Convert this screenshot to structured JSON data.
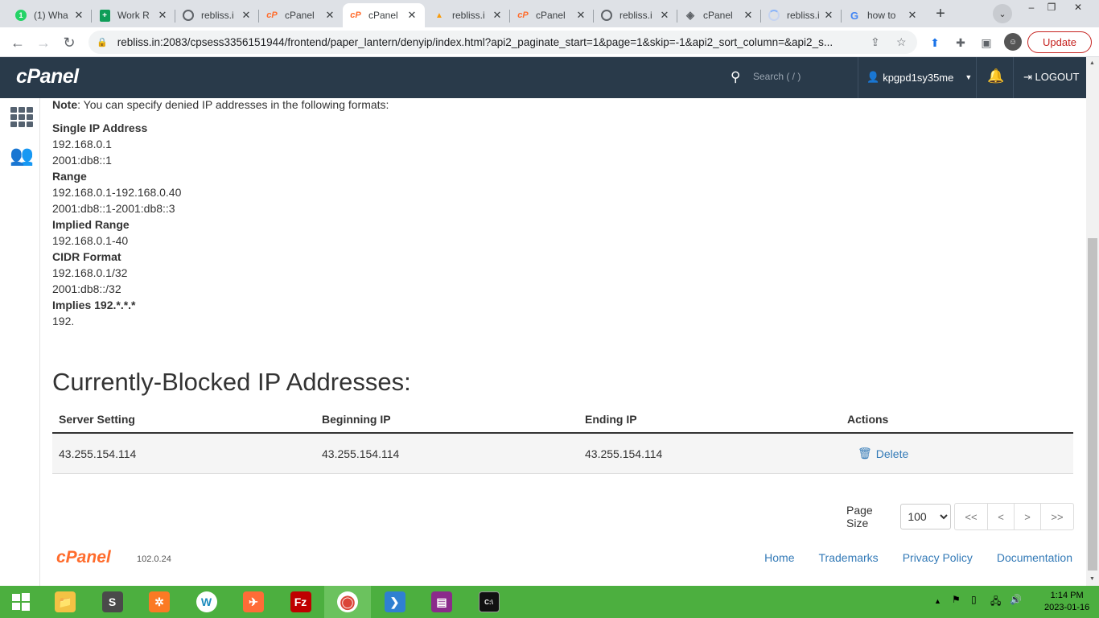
{
  "browser": {
    "tabs": [
      {
        "icon": "whatsapp-icon",
        "title": "(1) Wha",
        "active": false
      },
      {
        "icon": "sheets-icon",
        "title": "Work R",
        "active": false
      },
      {
        "icon": "globe-icon",
        "title": "rebliss.i",
        "active": false
      },
      {
        "icon": "cpanel-icon",
        "title": "cPanel",
        "active": false
      },
      {
        "icon": "cpanel-icon",
        "title": "cPanel",
        "active": true
      },
      {
        "icon": "phpmyadmin-icon",
        "title": "rebliss.i",
        "active": false
      },
      {
        "icon": "cpanel-icon",
        "title": "cPanel",
        "active": false
      },
      {
        "icon": "globe-icon",
        "title": "rebliss.i",
        "active": false
      },
      {
        "icon": "whm-icon",
        "title": "cPanel",
        "active": false
      },
      {
        "icon": "loading-icon",
        "title": "rebliss.i",
        "active": false
      },
      {
        "icon": "google-icon",
        "title": "how to",
        "active": false
      }
    ],
    "url": "rebliss.in:2083/cpsess3356151944/frontend/paper_lantern/denyip/index.html?api2_paginate_start=1&page=1&skip=-1&api2_sort_column=&api2_s...",
    "update_label": "Update"
  },
  "cpanel": {
    "logo": "cPanel",
    "search_placeholder": "Search ( / )",
    "username": "kpgpd1sy35me",
    "logout_label": "LOGOUT"
  },
  "content": {
    "note_label": "Note",
    "note_text": ": You can specify denied IP addresses in the following formats:",
    "formats": [
      {
        "text": "Single IP Address",
        "heading": true
      },
      {
        "text": "192.168.0.1",
        "heading": false
      },
      {
        "text": "2001:db8::1",
        "heading": false
      },
      {
        "text": "Range",
        "heading": true
      },
      {
        "text": "192.168.0.1-192.168.0.40",
        "heading": false
      },
      {
        "text": "2001:db8::1-2001:db8::3",
        "heading": false
      },
      {
        "text": "Implied Range",
        "heading": true
      },
      {
        "text": "192.168.0.1-40",
        "heading": false
      },
      {
        "text": "CIDR Format",
        "heading": true
      },
      {
        "text": "192.168.0.1/32",
        "heading": false
      },
      {
        "text": "2001:db8::/32",
        "heading": false
      },
      {
        "text": "Implies 192.*.*.*",
        "heading": true
      },
      {
        "text": "192.",
        "heading": false
      }
    ],
    "blocked_title": "Currently-Blocked IP Addresses:",
    "table": {
      "headers": [
        "Server Setting",
        "Beginning IP",
        "Ending IP",
        "Actions"
      ],
      "rows": [
        {
          "server_setting": "43.255.154.114",
          "beginning_ip": "43.255.154.114",
          "ending_ip": "43.255.154.114",
          "action": "Delete"
        }
      ]
    },
    "pager": {
      "label": "Page Size",
      "size": "100",
      "first": "<<",
      "prev": "<",
      "next": ">",
      "last": ">>"
    }
  },
  "footer": {
    "logo": "cPanel",
    "version": "102.0.24",
    "links": [
      "Home",
      "Trademarks",
      "Privacy Policy",
      "Documentation"
    ]
  },
  "taskbar": {
    "apps": [
      "file-explorer",
      "sublime-text",
      "xampp",
      "wordpress",
      "postman",
      "filezilla",
      "chrome",
      "vscode",
      "winrar",
      "terminal"
    ],
    "time": "1:14 PM",
    "date": "2023-01-16"
  },
  "colors": {
    "cpanel_bar": "#293a4a",
    "link": "#337ab7",
    "cpanel_orange": "#ff6c2c",
    "taskbar": "#4caf3f"
  }
}
